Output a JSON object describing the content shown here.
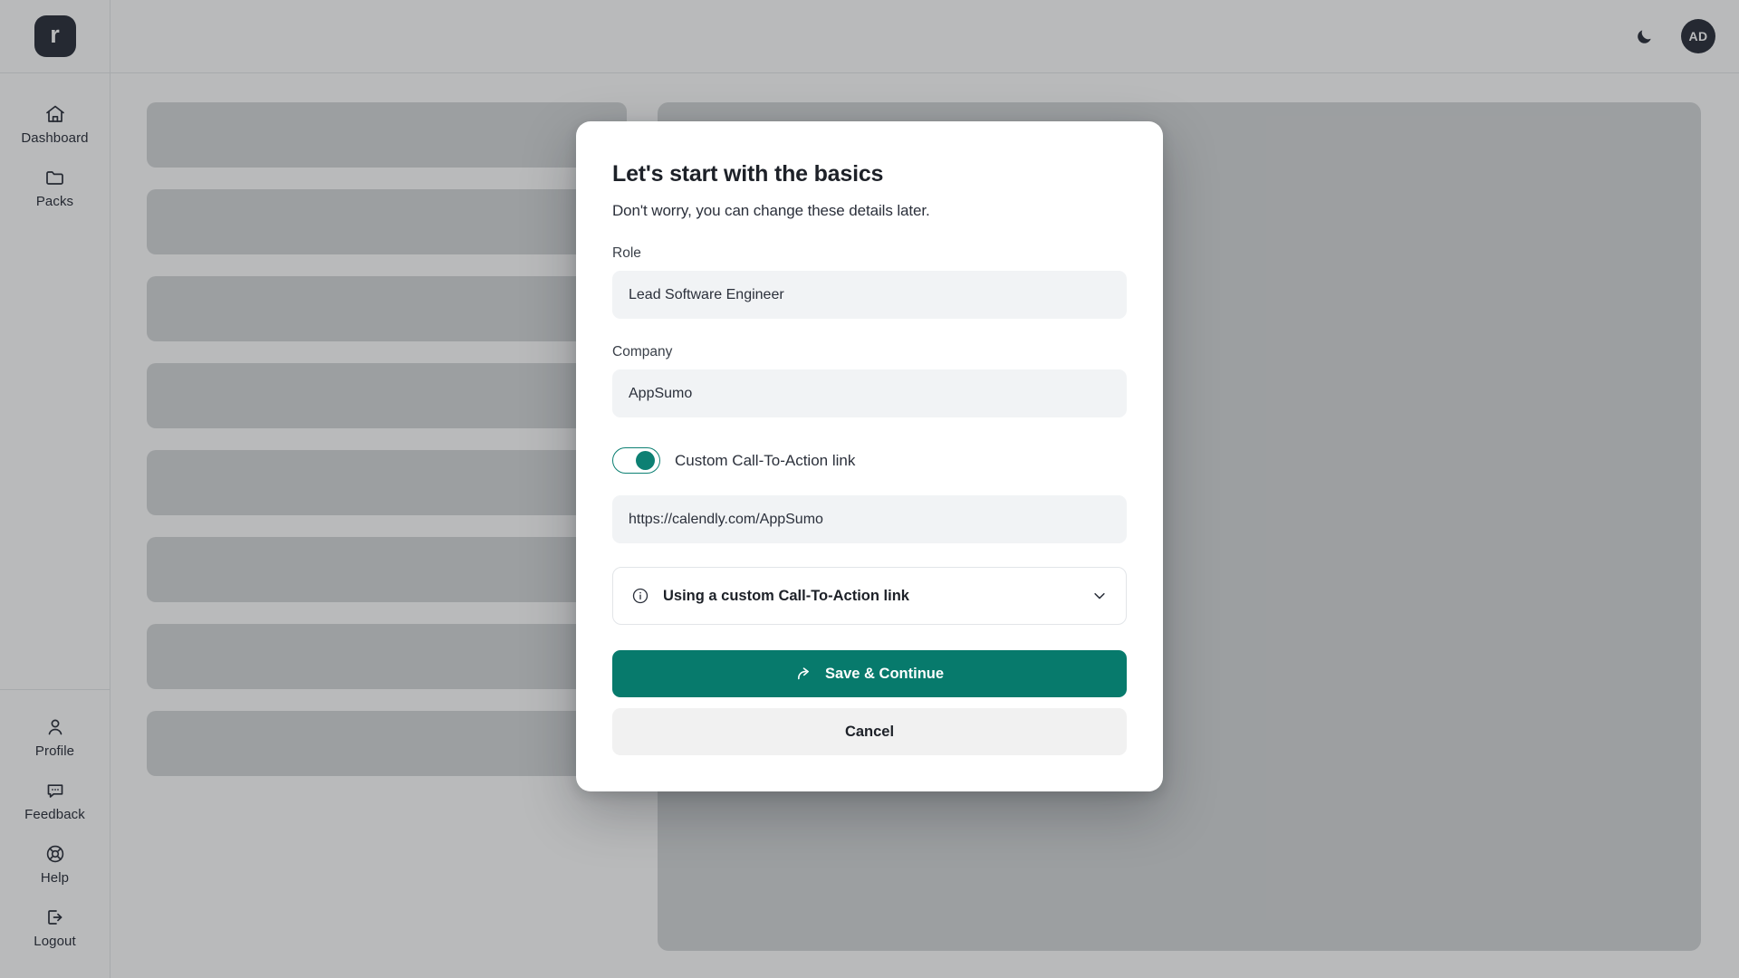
{
  "app": {
    "logo_letter": "r"
  },
  "sidebar": {
    "primary_items": [
      {
        "label": "Dashboard",
        "icon": "home-icon"
      },
      {
        "label": "Packs",
        "icon": "folder-icon"
      }
    ],
    "secondary_items": [
      {
        "label": "Profile",
        "icon": "user-icon"
      },
      {
        "label": "Feedback",
        "icon": "chat-bubble-icon"
      },
      {
        "label": "Help",
        "icon": "life-buoy-icon"
      },
      {
        "label": "Logout",
        "icon": "logout-icon"
      }
    ]
  },
  "topbar": {
    "theme_toggle_icon": "moon-icon",
    "avatar_initials": "AD"
  },
  "modal": {
    "title": "Let's start with the basics",
    "subtitle": "Don't worry, you can change these details later.",
    "role": {
      "label": "Role",
      "value": "Lead Software Engineer",
      "placeholder": "Role"
    },
    "company": {
      "label": "Company",
      "value": "AppSumo",
      "placeholder": "Company"
    },
    "cta_toggle": {
      "label": "Custom Call-To-Action link",
      "state": "on"
    },
    "cta_link": {
      "value": "https://calendly.com/AppSumo",
      "placeholder": "https://calendly.com/AppSumo"
    },
    "info_accordion": {
      "title": "Using a custom Call-To-Action link",
      "leading_icon": "info-circle-icon",
      "trailing_icon": "chevron-down-icon",
      "expanded": "false"
    },
    "primary_button": {
      "label": "Save & Continue",
      "icon": "share-arrow-icon"
    },
    "secondary_button": {
      "label": "Cancel"
    }
  },
  "colors": {
    "brand_teal": "#077a6c",
    "toggle_teal": "#0d8073",
    "ink": "#2b303b",
    "skeleton": "#d6d8da",
    "overlay": "rgba(24,26,30,0.30)"
  }
}
